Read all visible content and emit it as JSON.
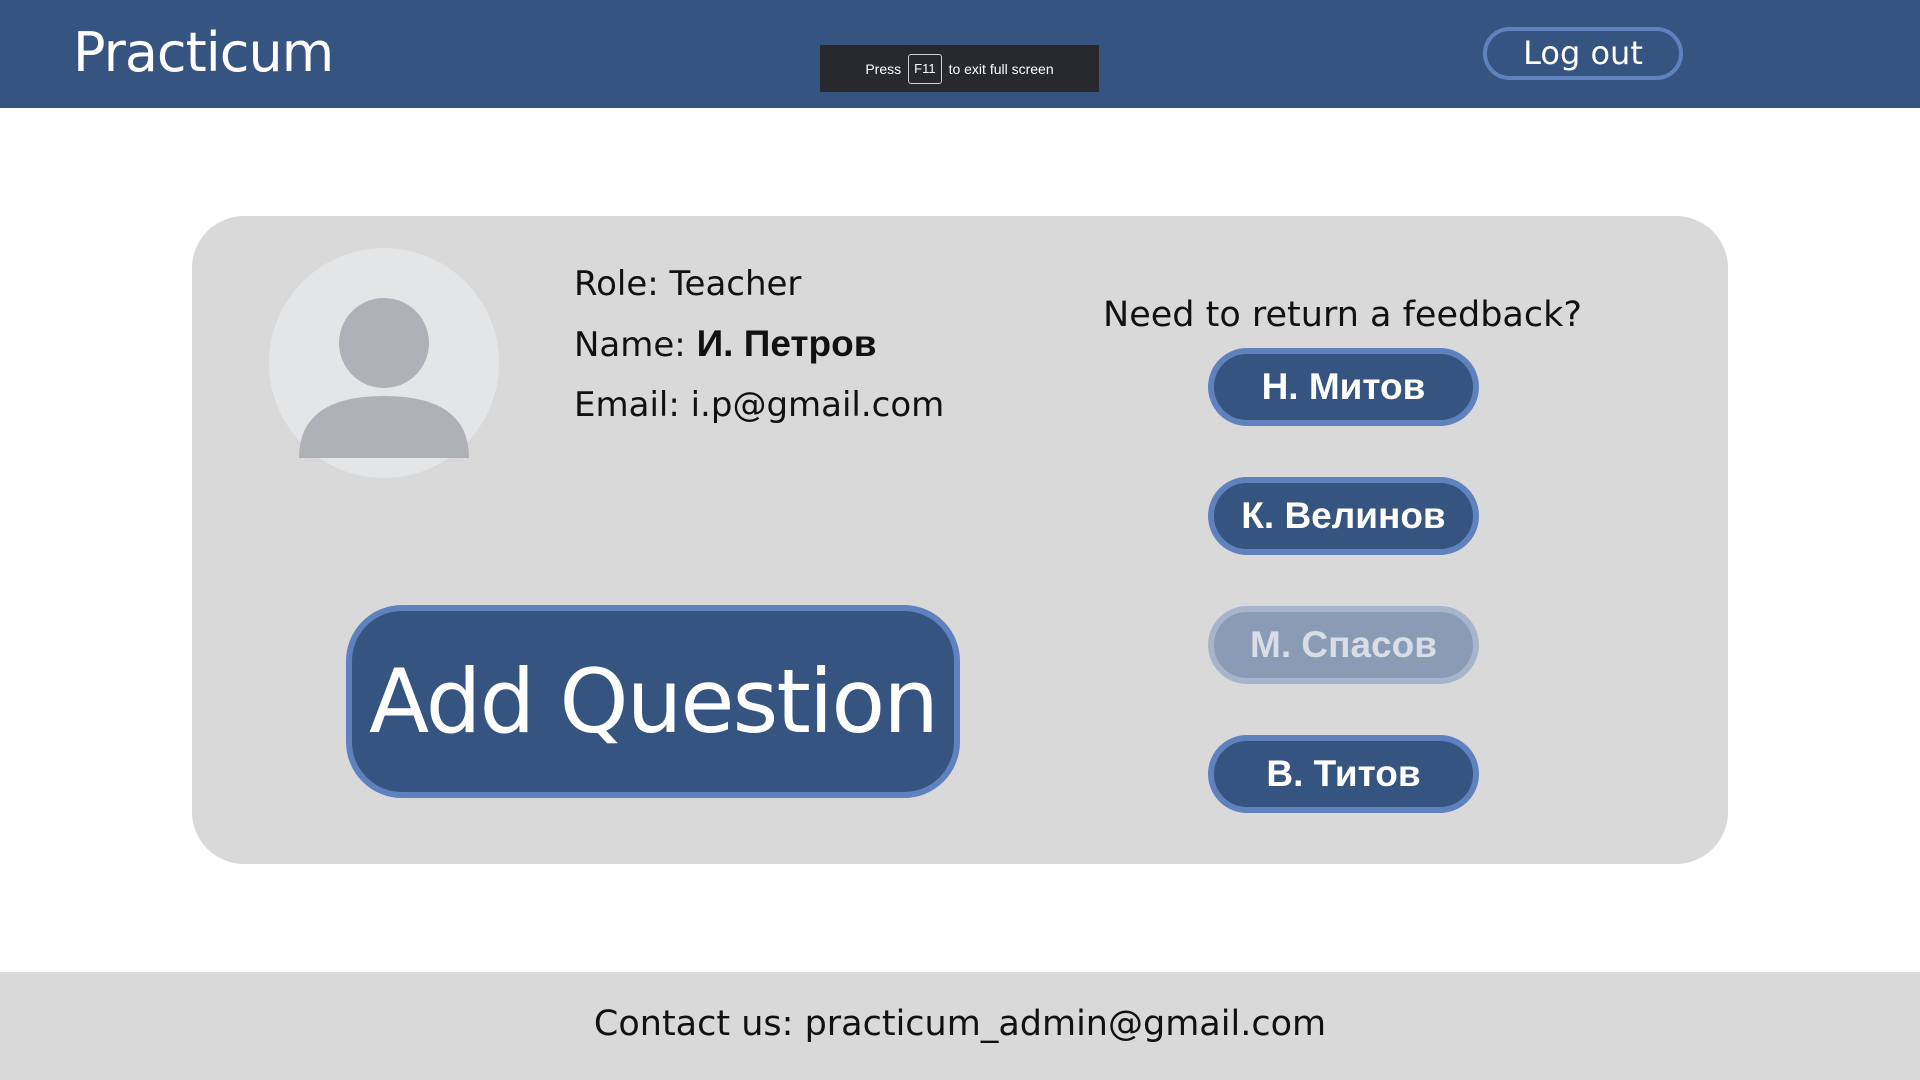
{
  "header": {
    "brand": "Practicum",
    "logout_label": "Log out"
  },
  "fullscreen_notice": {
    "before": "Press",
    "key": "F11",
    "after": "to exit full screen"
  },
  "profile": {
    "role_label": "Role:",
    "role_value": "Teacher",
    "name_label": "Name:",
    "name_value": "И. Петров",
    "email_label": "Email:",
    "email_value": "i.p@gmail.com",
    "avatar_icon": "user-avatar-icon"
  },
  "actions": {
    "add_question_label": "Add Question"
  },
  "feedback": {
    "title": "Need to return a feedback?",
    "students": [
      {
        "label": "Н. Митов",
        "enabled": true
      },
      {
        "label": "К. Велинов",
        "enabled": true
      },
      {
        "label": "М. Спасов",
        "enabled": false
      },
      {
        "label": "В. Титов",
        "enabled": true
      }
    ]
  },
  "footer": {
    "contact_label": "Contact us:",
    "contact_email": "practicum_admin@gmail.com"
  },
  "colors": {
    "primary": "#365480",
    "primary_border": "#5f82bf",
    "card_background": "#d9d9d9",
    "disabled_button": "#8a9bb6"
  }
}
